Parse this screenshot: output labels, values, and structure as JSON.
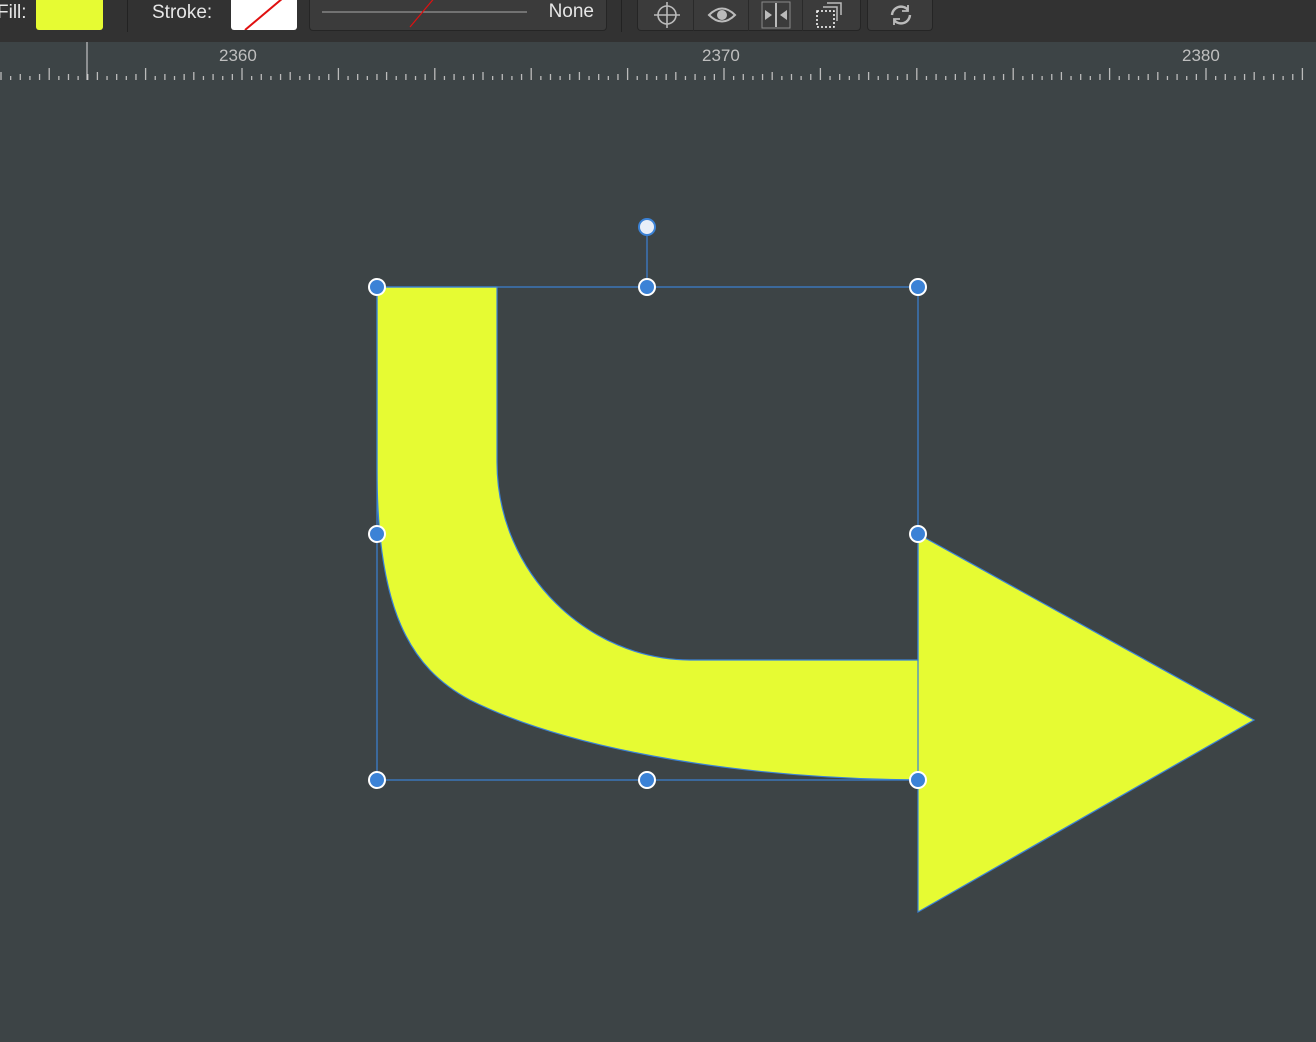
{
  "toolbar": {
    "fill_label": "Fill:",
    "fill_color": "#e6fb33",
    "stroke_label": "Stroke:",
    "stroke_width_value": "None",
    "buttons": [
      "snap-target-icon",
      "eye-preview-icon",
      "flip-horizontal-icon",
      "transform-origin-icon",
      "rotate-refresh-icon"
    ]
  },
  "ruler": {
    "labels": [
      "2360",
      "2370",
      "2380"
    ]
  },
  "shape": {
    "fill": "#e6fb33",
    "selection_color": "#3b82d6"
  }
}
